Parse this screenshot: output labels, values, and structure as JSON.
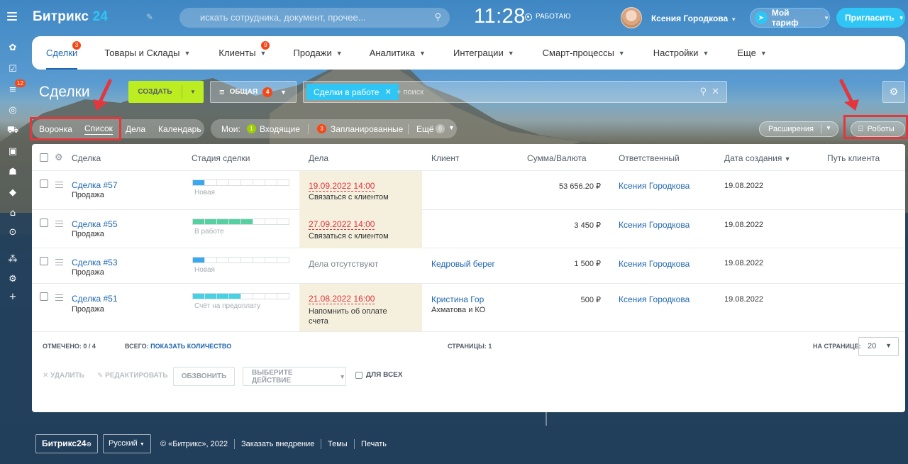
{
  "header": {
    "logo_main": "Битрикс",
    "logo_24": "24",
    "search_placeholder": "искать сотрудника, документ, прочее...",
    "time": "11:28",
    "work_status": "РАБОТАЮ",
    "user_name": "Ксения Городкова",
    "tariff_label": "Мой тариф",
    "invite_label": "Пригласить"
  },
  "left_bar": {
    "badge": "12"
  },
  "nav": {
    "tabs": [
      {
        "label": "Сделки",
        "badge": "3",
        "active": true
      },
      {
        "label": "Товары и Склады",
        "chev": true
      },
      {
        "label": "Клиенты",
        "badge": "9",
        "chev": true
      },
      {
        "label": "Продажи",
        "chev": true
      },
      {
        "label": "Аналитика",
        "chev": true
      },
      {
        "label": "Интеграции",
        "chev": true
      },
      {
        "label": "Смарт-процессы",
        "chev": true
      },
      {
        "label": "Настройки",
        "chev": true
      },
      {
        "label": "Еще",
        "chev": true
      }
    ]
  },
  "toolbar": {
    "title": "Сделки",
    "create_label": "СОЗДАТЬ",
    "preset_label": "ОБЩАЯ",
    "preset_count": "4",
    "filter_tag": "Сделки в работе",
    "filter_placeholder": "+ поиск"
  },
  "views": {
    "funnel": "Воронка",
    "list": "Список",
    "activities": "Дела",
    "calendar": "Календарь"
  },
  "my": {
    "label": "Мои:",
    "incoming_count": "1",
    "incoming_label": "Входящие",
    "planned_count": "3",
    "planned_label": "Запланированные",
    "more_label": "Ещё",
    "more_count": "0"
  },
  "right_actions": {
    "expand_label": "Расширения",
    "robots_label": "Роботы"
  },
  "grid": {
    "columns": {
      "deal": "Сделка",
      "stage": "Стадия сделки",
      "activity": "Дела",
      "client": "Клиент",
      "amount": "Сумма/Валюта",
      "responsible": "Ответственный",
      "created": "Дата создания",
      "journey": "Путь клиента"
    },
    "rows": [
      {
        "title": "Сделка #57",
        "type": "Продажа",
        "stage": "Новая",
        "stage_fill": 0.15,
        "stage_color": "#39a8ef",
        "act_date": "19.09.2022 14:00",
        "act_text": "Связаться с клиентом",
        "client": "",
        "client_sub": "",
        "amount": "53 656.20 ₽",
        "responsible": "Ксения Городкова",
        "created": "19.08.2022"
      },
      {
        "title": "Сделка #55",
        "type": "Продажа",
        "stage": "В работе",
        "stage_fill": 0.67,
        "stage_color": "#55d0a0",
        "act_date": "27.09.2022 14:00",
        "act_text": "Связаться с клиентом",
        "client": "",
        "client_sub": "",
        "amount": "3 450 ₽",
        "responsible": "Ксения Городкова",
        "created": "19.08.2022"
      },
      {
        "title": "Сделка #53",
        "type": "Продажа",
        "stage": "Новая",
        "stage_fill": 0.15,
        "stage_color": "#39a8ef",
        "no_activity": "Дела отсутствуют",
        "client": "Кедровый берег",
        "client_sub": "",
        "amount": "1 500 ₽",
        "responsible": "Ксения Городкова",
        "created": "19.08.2022"
      },
      {
        "title": "Сделка #51",
        "type": "Продажа",
        "stage": "Счёт на предоплату",
        "stage_fill": 0.5,
        "stage_color": "#47d1e2",
        "act_date": "21.08.2022 16:00",
        "act_text_1": "Напомнить об оплате",
        "act_text_2": "счета",
        "client": "Кристина Гор",
        "client_sub": "Ахматова и КО",
        "amount": "500 ₽",
        "responsible": "Ксения Городкова",
        "created": "19.08.2022"
      }
    ],
    "footer": {
      "marked": "ОТМЕЧЕНО: 0 / 4",
      "total_label": "ВСЕГО:",
      "show_count": "ПОКАЗАТЬ КОЛИЧЕСТВО",
      "pages": "СТРАНИЦЫ: 1",
      "per_page_label": "НА СТРАНИЦЕ:",
      "per_page_value": "20"
    },
    "actions": {
      "delete": "УДАЛИТЬ",
      "edit": "РЕДАКТИРОВАТЬ",
      "call": "ОБЗВОНИТЬ",
      "choose": "ВЫБЕРИТЕ ДЕЙСТВИЕ",
      "for_all": "ДЛЯ ВСЕХ"
    }
  },
  "footer": {
    "logo": "Битрикс24",
    "lang": "Русский",
    "copyright": "© «Битрикс», 2022",
    "order": "Заказать внедрение",
    "themes": "Темы",
    "print": "Печать"
  },
  "colors": {
    "accent": "#2fc6f6",
    "link": "#2067b0",
    "create": "#bbed21",
    "badge": "#f54819",
    "highlight": "#e2373d"
  }
}
